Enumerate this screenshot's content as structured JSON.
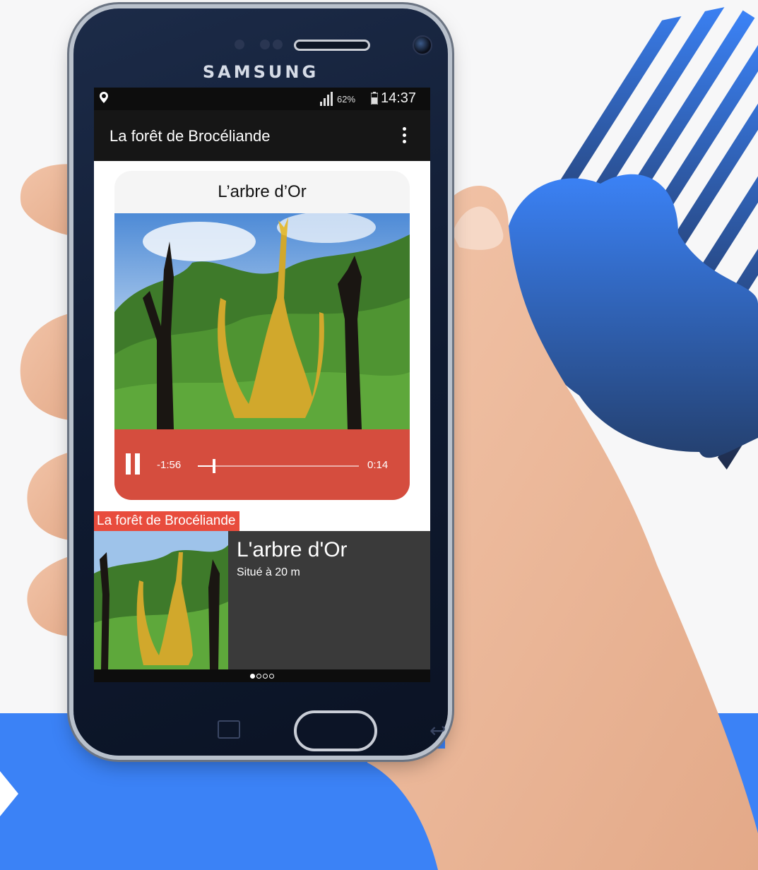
{
  "device": {
    "brand": "SAMSUNG"
  },
  "status_bar": {
    "battery": "62%",
    "time": "14:37"
  },
  "app_bar": {
    "title": "La forêt de Brocéliande"
  },
  "card": {
    "title": "L’arbre d’Or",
    "player": {
      "remaining": "-1:56",
      "elapsed": "0:14",
      "progress": 0.1
    }
  },
  "caption_tag": "La forêt de Brocéliande",
  "list_item": {
    "title": "L'arbre d'Or",
    "subtitle": "Situé à 20 m"
  },
  "pager": {
    "pages": 4,
    "current": 0
  },
  "colors": {
    "accent_red": "#d54d3e",
    "brand_blue": "#3b82f6",
    "phone_navy": "#14213a"
  }
}
